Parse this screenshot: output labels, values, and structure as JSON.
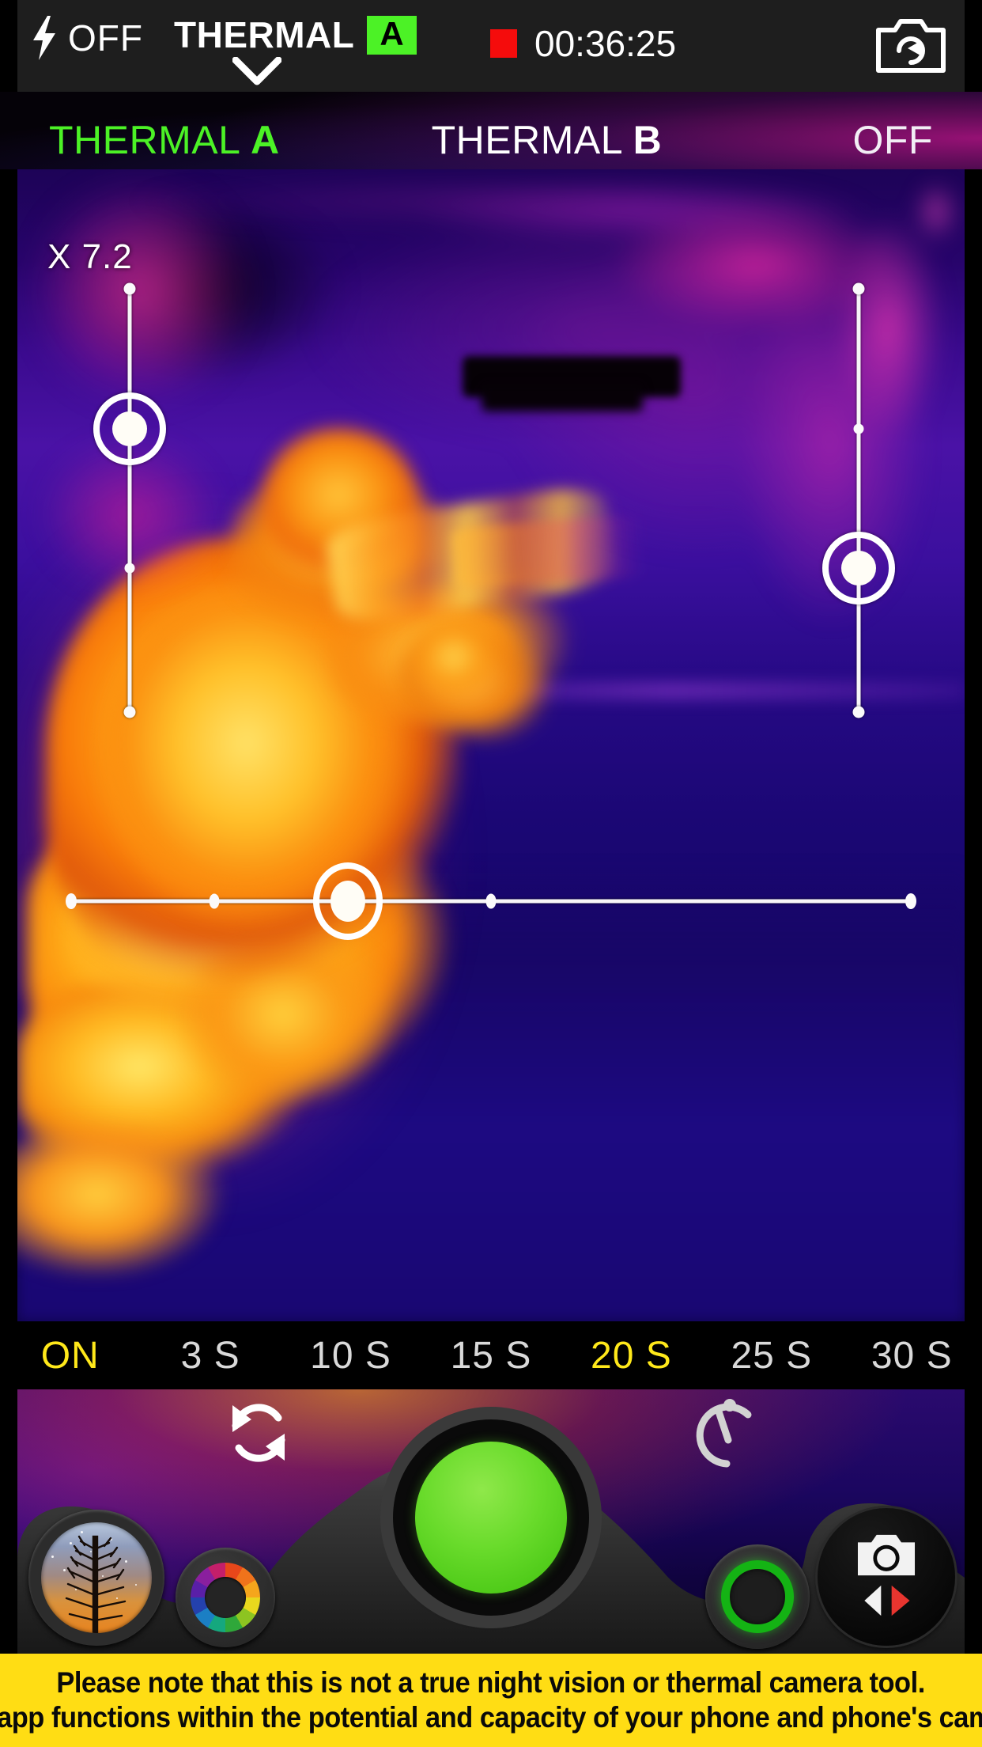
{
  "header": {
    "flash_icon": "lightning-bolt-icon",
    "flash_label": "OFF",
    "mode_title": "THERMAL",
    "mode_badge": "A",
    "chevron_icon": "chevron-down-icon",
    "recording_indicator": "record-dot-icon",
    "recording_time": "00:36:25",
    "camera_flip_icon": "camera-flip-icon",
    "accent_green": "#4cf226",
    "record_red": "#f50c0c"
  },
  "mode_row": {
    "options": [
      {
        "label": "THERMAL",
        "bold": "A",
        "active": true,
        "color": "#4cf226"
      },
      {
        "label": "THERMAL",
        "bold": "B",
        "active": false,
        "color": "#ffffff"
      },
      {
        "label": "OFF",
        "bold": "",
        "active": false,
        "color": "#f2eef5"
      }
    ]
  },
  "viewfinder": {
    "zoom_label": "X 7.2",
    "scene_description": "thermal-palette-view-of-kneeling-person-aiming",
    "zoom_slider": {
      "name": "zoom-slider",
      "value_position_pct": 33,
      "ticks_pct": [
        66
      ]
    },
    "right_slider": {
      "name": "brightness-slider",
      "value_position_pct": 66,
      "ticks_pct": [
        33
      ]
    },
    "bottom_slider": {
      "name": "contrast-slider",
      "value_position_pct": 33,
      "ticks_pct": [
        17,
        50
      ]
    }
  },
  "timer_row": {
    "options": [
      {
        "label": "ON",
        "active": true
      },
      {
        "label": "3 S",
        "active": false
      },
      {
        "label": "10 S",
        "active": false
      },
      {
        "label": "15 S",
        "active": false
      },
      {
        "label": "20 S",
        "active": true
      },
      {
        "label": "25 S",
        "active": false
      },
      {
        "label": "30 S",
        "active": false
      }
    ],
    "active_color": "#ffe81a",
    "inactive_color": "#d9d9d9"
  },
  "deck": {
    "refresh_icon": "refresh-rotate-icon",
    "timer_icon": "timer-stopwatch-icon",
    "gallery_button": "gallery-thumbnail-button",
    "palette_button": "color-palette-wheel-button",
    "shutter_button": "shutter-button",
    "shutter_color": "#4cc917",
    "mode_ring_button": "recording-mode-ring-button",
    "mode_ring_color": "#14b314",
    "camera_switch_button": "camera-switch-button",
    "camera_switch_icon": "camera-icon",
    "prev_arrow_icon": "chevron-left-icon",
    "next_arrow_icon": "chevron-right-icon",
    "next_arrow_color": "#e8352f"
  },
  "warning": {
    "background": "#ffdd14",
    "line1": "Please note that this is not a true night vision or thermal camera tool.",
    "line2": "The app functions within the potential and capacity of your phone and phone's camera."
  }
}
